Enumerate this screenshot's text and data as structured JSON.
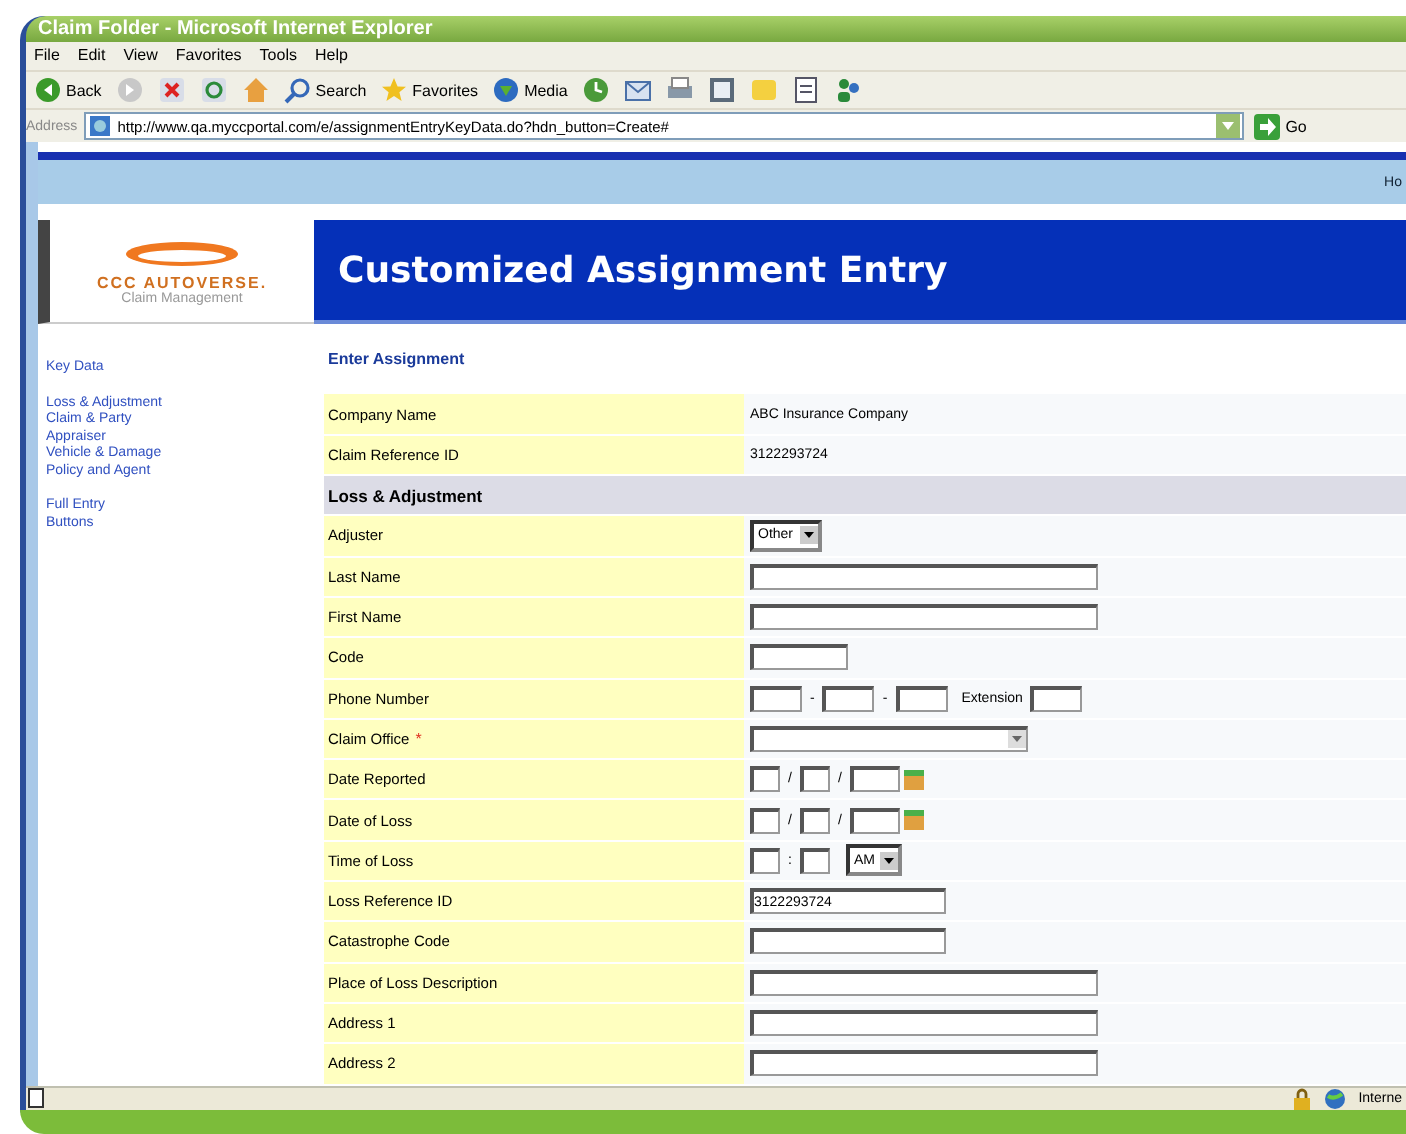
{
  "window": {
    "title": "Claim Folder - Microsoft Internet Explorer"
  },
  "menu": [
    "File",
    "Edit",
    "View",
    "Favorites",
    "Tools",
    "Help"
  ],
  "toolbar": [
    {
      "kind": "back",
      "label": "Back"
    },
    {
      "kind": "forward"
    },
    {
      "kind": "stop"
    },
    {
      "kind": "refresh"
    },
    {
      "kind": "home"
    },
    {
      "kind": "search",
      "label": "Search"
    },
    {
      "kind": "favorites",
      "label": "Favorites"
    },
    {
      "kind": "media",
      "label": "Media"
    },
    {
      "kind": "history"
    },
    {
      "kind": "mail"
    },
    {
      "kind": "print"
    },
    {
      "kind": "edit"
    },
    {
      "kind": "note"
    },
    {
      "kind": "page"
    },
    {
      "kind": "messenger"
    }
  ],
  "address_bar": {
    "label": "Address",
    "value": "http://www.qa.myccportal.com/e/assignmentEntryKeyData.do?hdn_button=Create#",
    "go": "Go"
  },
  "top_bar": {
    "link": "Ho"
  },
  "logo": {
    "brand": "CCC AUTOVERSE.",
    "subtitle": "Claim Management"
  },
  "header": {
    "title": "Customized Assignment Entry"
  },
  "sidebar": {
    "groups": [
      [
        "Key Data"
      ],
      [
        "Loss & Adjustment",
        "Claim & Party",
        "Appraiser",
        "Vehicle & Damage",
        "Policy and Agent"
      ],
      [
        "Full Entry",
        "Buttons"
      ]
    ]
  },
  "form": {
    "title": "Enter Assignment",
    "rows": [
      {
        "kind": "static",
        "label": "Company Name",
        "value": "ABC Insurance Company"
      },
      {
        "kind": "static",
        "label": "Claim Reference ID",
        "value": "3122293724"
      },
      {
        "kind": "section",
        "label": "Loss & Adjustment"
      },
      {
        "kind": "select",
        "label": "Adjuster",
        "value": "Other"
      },
      {
        "kind": "long-field",
        "label": "Last Name"
      },
      {
        "kind": "long-field",
        "label": "First Name"
      },
      {
        "kind": "short-field",
        "label": "Code"
      },
      {
        "kind": "phone",
        "label": "Phone Number",
        "separators": [
          "-",
          "-"
        ],
        "extension_label": "Extension"
      },
      {
        "kind": "wide-select",
        "label": "Claim Office",
        "required_mark": "*"
      },
      {
        "kind": "date",
        "label": "Date Reported",
        "separators": [
          "/",
          "/"
        ]
      },
      {
        "kind": "date",
        "label": "Date of Loss",
        "separators": [
          "/",
          "/"
        ]
      },
      {
        "kind": "time",
        "label": "Time of Loss",
        "separators": [
          ":"
        ],
        "meridiem": "AM"
      },
      {
        "kind": "medium-field",
        "label": "Loss Reference ID",
        "value": "3122293724"
      },
      {
        "kind": "medium-field",
        "label": "Catastrophe Code"
      },
      {
        "kind": "long-field",
        "label": "Place of Loss Description"
      },
      {
        "kind": "long-field",
        "label": "Address 1"
      },
      {
        "kind": "long-field",
        "label": "Address 2"
      }
    ]
  },
  "status_bar": {
    "zone": "Interne"
  }
}
